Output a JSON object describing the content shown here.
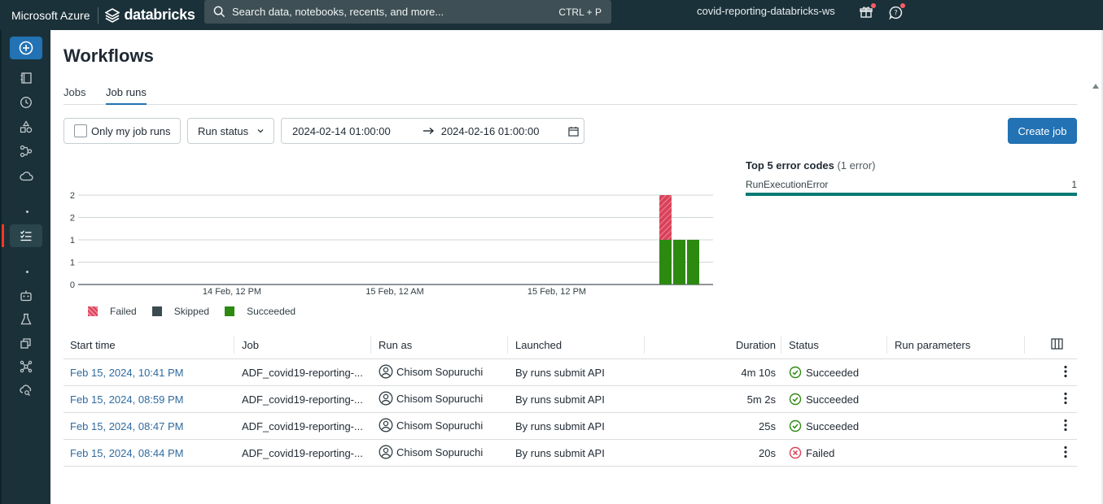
{
  "topbar": {
    "azure_label": "Microsoft Azure",
    "databricks_label": "databricks",
    "search_placeholder": "Search data, notebooks, recents, and more...",
    "search_shortcut": "CTRL + P",
    "workspace_name": "covid-reporting-databricks-ws"
  },
  "page": {
    "title": "Workflows",
    "tabs": [
      {
        "label": "Jobs",
        "active": false
      },
      {
        "label": "Job runs",
        "active": true
      }
    ]
  },
  "filters": {
    "only_my_runs_label": "Only my job runs",
    "only_my_runs_checked": false,
    "run_status_label": "Run status",
    "date_from": "2024-02-14 01:00:00",
    "date_to": "2024-02-16 01:00:00",
    "create_job_label": "Create job"
  },
  "chart_data": {
    "type": "bar",
    "stacked": true,
    "y_ticks": [
      "2",
      "2",
      "1",
      "1",
      "0"
    ],
    "x_ticks": [
      "14 Feb, 12 PM",
      "15 Feb, 12 AM",
      "15 Feb, 12 PM"
    ],
    "categories": [
      "Feb 15, 2024, 08:44 PM",
      "Feb 15, 2024, 08:47 PM",
      "Feb 15, 2024, 08:59 PM"
    ],
    "series": [
      {
        "name": "Failed",
        "color": "#d9425a",
        "pattern": "hatched",
        "values": [
          1,
          0,
          0
        ]
      },
      {
        "name": "Skipped",
        "color": "#3b4a51",
        "values": [
          0,
          0,
          0
        ]
      },
      {
        "name": "Succeeded",
        "color": "#2d8a11",
        "values": [
          1,
          1,
          1
        ]
      }
    ],
    "ylim": [
      0,
      2
    ],
    "grid": true,
    "legend_position": "bottom-left"
  },
  "error_codes": {
    "title": "Top 5 error codes",
    "count_label": "(1 error)",
    "items": [
      {
        "code": "RunExecutionError",
        "count": "1",
        "share": 1.0
      }
    ]
  },
  "table": {
    "columns": [
      "Start time",
      "Job",
      "Run as",
      "Launched",
      "Duration",
      "Status",
      "Run parameters"
    ],
    "rows": [
      {
        "start_time": "Feb 15, 2024, 10:41 PM",
        "job": "ADF_covid19-reporting-...",
        "run_as": "Chisom Sopuruchi",
        "launched": "By runs submit API",
        "duration": "4m 10s",
        "status": "Succeeded",
        "params": ""
      },
      {
        "start_time": "Feb 15, 2024, 08:59 PM",
        "job": "ADF_covid19-reporting-...",
        "run_as": "Chisom Sopuruchi",
        "launched": "By runs submit API",
        "duration": "5m 2s",
        "status": "Succeeded",
        "params": ""
      },
      {
        "start_time": "Feb 15, 2024, 08:47 PM",
        "job": "ADF_covid19-reporting-...",
        "run_as": "Chisom Sopuruchi",
        "launched": "By runs submit API",
        "duration": "25s",
        "status": "Succeeded",
        "params": ""
      },
      {
        "start_time": "Feb 15, 2024, 08:44 PM",
        "job": "ADF_covid19-reporting-...",
        "run_as": "Chisom Sopuruchi",
        "launched": "By runs submit API",
        "duration": "20s",
        "status": "Failed",
        "params": ""
      }
    ]
  },
  "colors": {
    "brand_dark": "#1b3139",
    "primary": "#2272b4",
    "success": "#2d8a11",
    "failed": "#d9425a",
    "error_bar": "#077a73"
  }
}
